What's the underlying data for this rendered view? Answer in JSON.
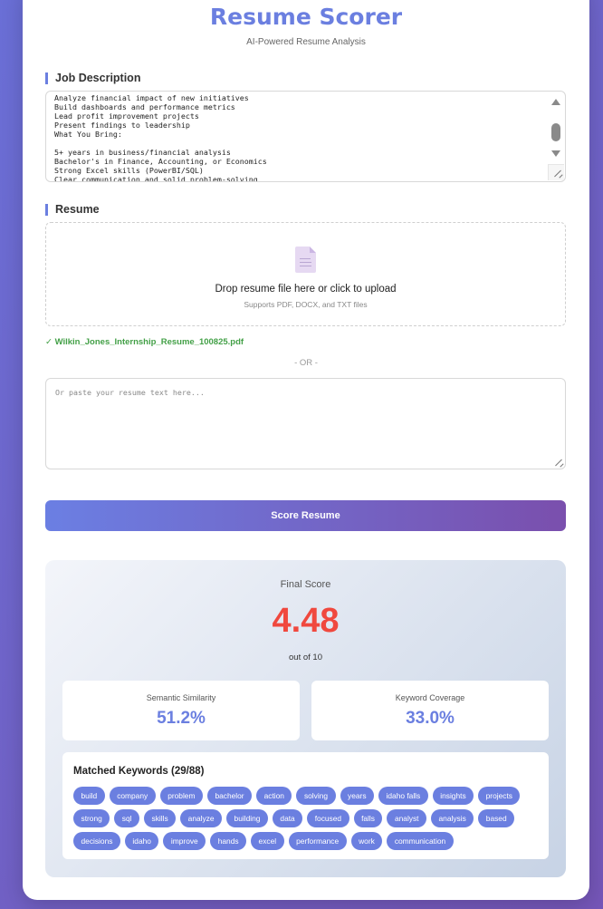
{
  "header": {
    "title": "Resume Scorer",
    "subtitle": "AI-Powered Resume Analysis"
  },
  "job_description": {
    "label": "Job Description",
    "text": "Analyze financial impact of new initiatives\nBuild dashboards and performance metrics\nLead profit improvement projects\nPresent findings to leadership\nWhat You Bring:\n\n5+ years in business/financial analysis\nBachelor's in Finance, Accounting, or Economics\nStrong Excel skills (PowerBI/SQL)\nClear communication and solid problem-solving"
  },
  "resume": {
    "label": "Resume",
    "drop_main": "Drop resume file here or click to upload",
    "drop_sub": "Supports PDF, DOCX, and TXT files",
    "uploaded_file": "✓ Wilkin_Jones_Internship_Resume_100825.pdf",
    "or_text": "- OR -",
    "paste_placeholder": "Or paste your resume text here...",
    "paste_value": ""
  },
  "actions": {
    "score_label": "Score Resume"
  },
  "results": {
    "final_label": "Final Score",
    "final_score": "4.48",
    "out_of": "out of 10",
    "semantic_label": "Semantic Similarity",
    "semantic_value": "51.2%",
    "keyword_label": "Keyword Coverage",
    "keyword_value": "33.0%",
    "matched_title": "Matched Keywords (29/88)",
    "keywords": [
      "build",
      "company",
      "problem",
      "bachelor",
      "action",
      "solving",
      "years",
      "idaho falls",
      "insights",
      "projects",
      "strong",
      "sql",
      "skills",
      "analyze",
      "building",
      "data",
      "focused",
      "falls",
      "analyst",
      "analysis",
      "based",
      "decisions",
      "idaho",
      "improve",
      "hands",
      "excel",
      "performance",
      "work",
      "communication"
    ]
  },
  "colors": {
    "accent": "#6b7fe0",
    "score_red": "#f0483e",
    "success_green": "#43a047",
    "gradient_start": "#6b7fe3",
    "gradient_end": "#7a4fad"
  },
  "icons": {
    "upload": "document-icon"
  }
}
